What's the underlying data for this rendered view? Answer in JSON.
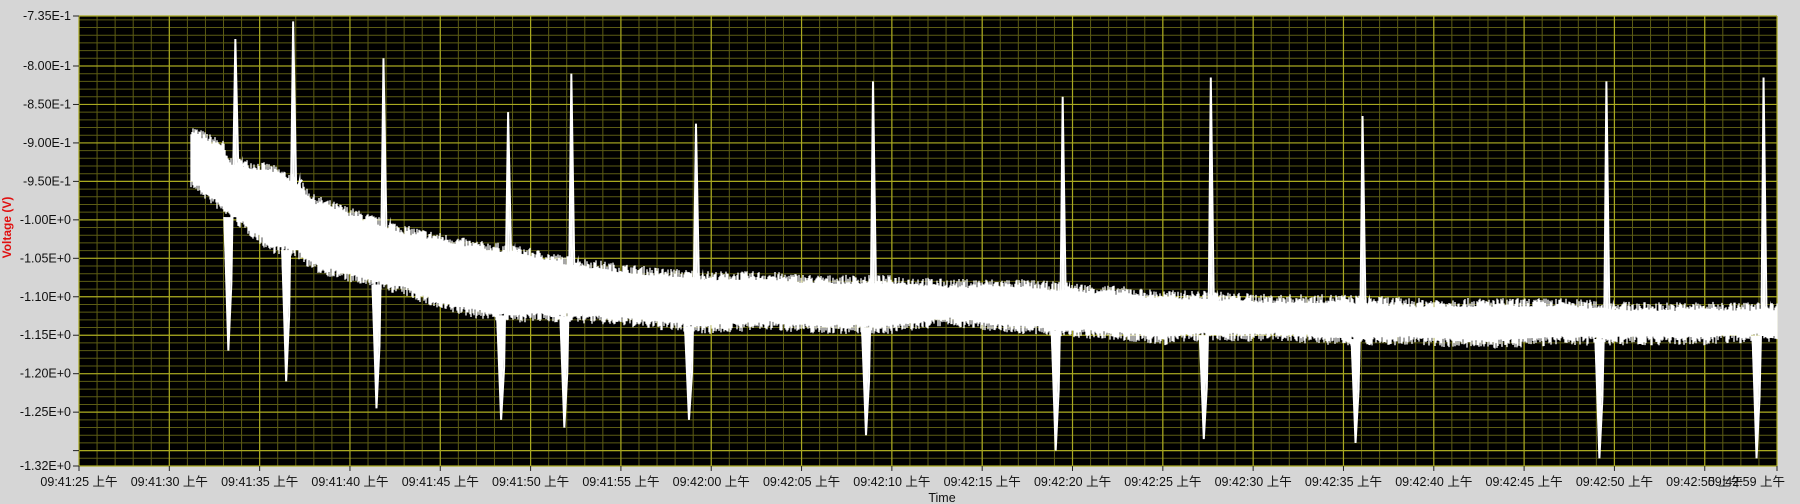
{
  "chart_data": {
    "type": "line",
    "title": "",
    "xlabel": "Time",
    "ylabel": "Voltage (V)",
    "grid": true,
    "legend": "none",
    "colors": {
      "plot_background": "#000000",
      "major_grid": "#a8a820",
      "minor_grid": "#5c5c14",
      "trace": "#ffffff",
      "ylabel": "#e01010",
      "frame": "#d6d6d6"
    },
    "y_range": [
      -1.32,
      -0.735
    ],
    "x_range_seconds": [
      0,
      94
    ],
    "y_major_ticks": [
      -1.32,
      -1.3,
      -1.25,
      -1.2,
      -1.15,
      -1.1,
      -1.05,
      -1.0,
      -0.95,
      -0.9,
      -0.85,
      -0.8,
      -0.735
    ],
    "y_tick_labels": [
      "-1.32E+0",
      "",
      "-1.25E+0",
      "-1.20E+0",
      "-1.15E+0",
      "-1.10E+0",
      "-1.05E+0",
      "-1.00E+0",
      "-9.50E-1",
      "-9.00E-1",
      "-8.50E-1",
      "-8.00E-1",
      "-7.35E-1"
    ],
    "x_tick_labels": [
      "09:41:25 上午",
      "09:41:30 上午",
      "09:41:35 上午",
      "09:41:40 上午",
      "09:41:45 上午",
      "09:41:50 上午",
      "09:41:55 上午",
      "09:42:00 上午",
      "09:42:05 上午",
      "09:42:10 上午",
      "09:42:15 上午",
      "09:42:20 上午",
      "09:42:25 上午",
      "09:42:30 上午",
      "09:42:35 上午",
      "09:42:40 上午",
      "09:42:45 上午",
      "09:42:50 上午",
      "09:42:55 上午",
      "09:42:59 上午"
    ],
    "x_tick_seconds": [
      0,
      5,
      10,
      15,
      20,
      25,
      30,
      35,
      40,
      45,
      50,
      55,
      60,
      65,
      70,
      75,
      80,
      85,
      90,
      94
    ],
    "series": [
      {
        "trace_start_seconds": 6.2,
        "trace_end_seconds": 94,
        "upper_envelope": [
          [
            6.2,
            -0.885
          ],
          [
            8,
            -0.905
          ],
          [
            8.2,
            -0.925
          ],
          [
            10.6,
            -0.935
          ],
          [
            12,
            -0.95
          ],
          [
            13,
            -0.975
          ],
          [
            16,
            -1.0
          ],
          [
            18,
            -1.015
          ],
          [
            20,
            -1.025
          ],
          [
            22,
            -1.035
          ],
          [
            24,
            -1.04
          ],
          [
            27,
            -1.055
          ],
          [
            30,
            -1.065
          ],
          [
            32,
            -1.07
          ],
          [
            35,
            -1.075
          ],
          [
            38,
            -1.075
          ],
          [
            41,
            -1.08
          ],
          [
            45,
            -1.08
          ],
          [
            48,
            -1.085
          ],
          [
            52,
            -1.085
          ],
          [
            55,
            -1.09
          ],
          [
            58,
            -1.095
          ],
          [
            60,
            -1.1
          ],
          [
            62,
            -1.1
          ],
          [
            66,
            -1.105
          ],
          [
            70,
            -1.105
          ],
          [
            74,
            -1.11
          ],
          [
            78,
            -1.11
          ],
          [
            82,
            -1.11
          ],
          [
            86,
            -1.115
          ],
          [
            90,
            -1.115
          ],
          [
            94,
            -1.115
          ]
        ],
        "lower_envelope": [
          [
            6.2,
            -0.95
          ],
          [
            8,
            -0.985
          ],
          [
            10.6,
            -1.035
          ],
          [
            12,
            -1.04
          ],
          [
            13,
            -1.06
          ],
          [
            16,
            -1.08
          ],
          [
            18,
            -1.09
          ],
          [
            20,
            -1.11
          ],
          [
            22,
            -1.12
          ],
          [
            24,
            -1.125
          ],
          [
            27,
            -1.125
          ],
          [
            30,
            -1.13
          ],
          [
            32,
            -1.135
          ],
          [
            35,
            -1.14
          ],
          [
            38,
            -1.135
          ],
          [
            41,
            -1.14
          ],
          [
            45,
            -1.14
          ],
          [
            48,
            -1.13
          ],
          [
            52,
            -1.14
          ],
          [
            55,
            -1.145
          ],
          [
            58,
            -1.15
          ],
          [
            60,
            -1.155
          ],
          [
            62,
            -1.15
          ],
          [
            66,
            -1.15
          ],
          [
            70,
            -1.155
          ],
          [
            74,
            -1.155
          ],
          [
            78,
            -1.16
          ],
          [
            82,
            -1.155
          ],
          [
            86,
            -1.155
          ],
          [
            90,
            -1.155
          ],
          [
            94,
            -1.15
          ]
        ],
        "spikes": [
          {
            "t": 8.6,
            "min": -1.17,
            "max": -0.765
          },
          {
            "t": 11.8,
            "min": -1.21,
            "max": -0.742
          },
          {
            "t": 16.8,
            "min": -1.245,
            "max": -0.79
          },
          {
            "t": 23.7,
            "min": -1.26,
            "max": -0.86
          },
          {
            "t": 27.2,
            "min": -1.27,
            "max": -0.81
          },
          {
            "t": 34.1,
            "min": -1.26,
            "max": -0.875
          },
          {
            "t": 43.9,
            "min": -1.28,
            "max": -0.82
          },
          {
            "t": 54.4,
            "min": -1.3,
            "max": -0.84
          },
          {
            "t": 62.6,
            "min": -1.285,
            "max": -0.815
          },
          {
            "t": 71.0,
            "min": -1.29,
            "max": -0.865
          },
          {
            "t": 84.5,
            "min": -1.31,
            "max": -0.82
          },
          {
            "t": 93.2,
            "min": -1.31,
            "max": -0.815
          }
        ]
      }
    ]
  }
}
